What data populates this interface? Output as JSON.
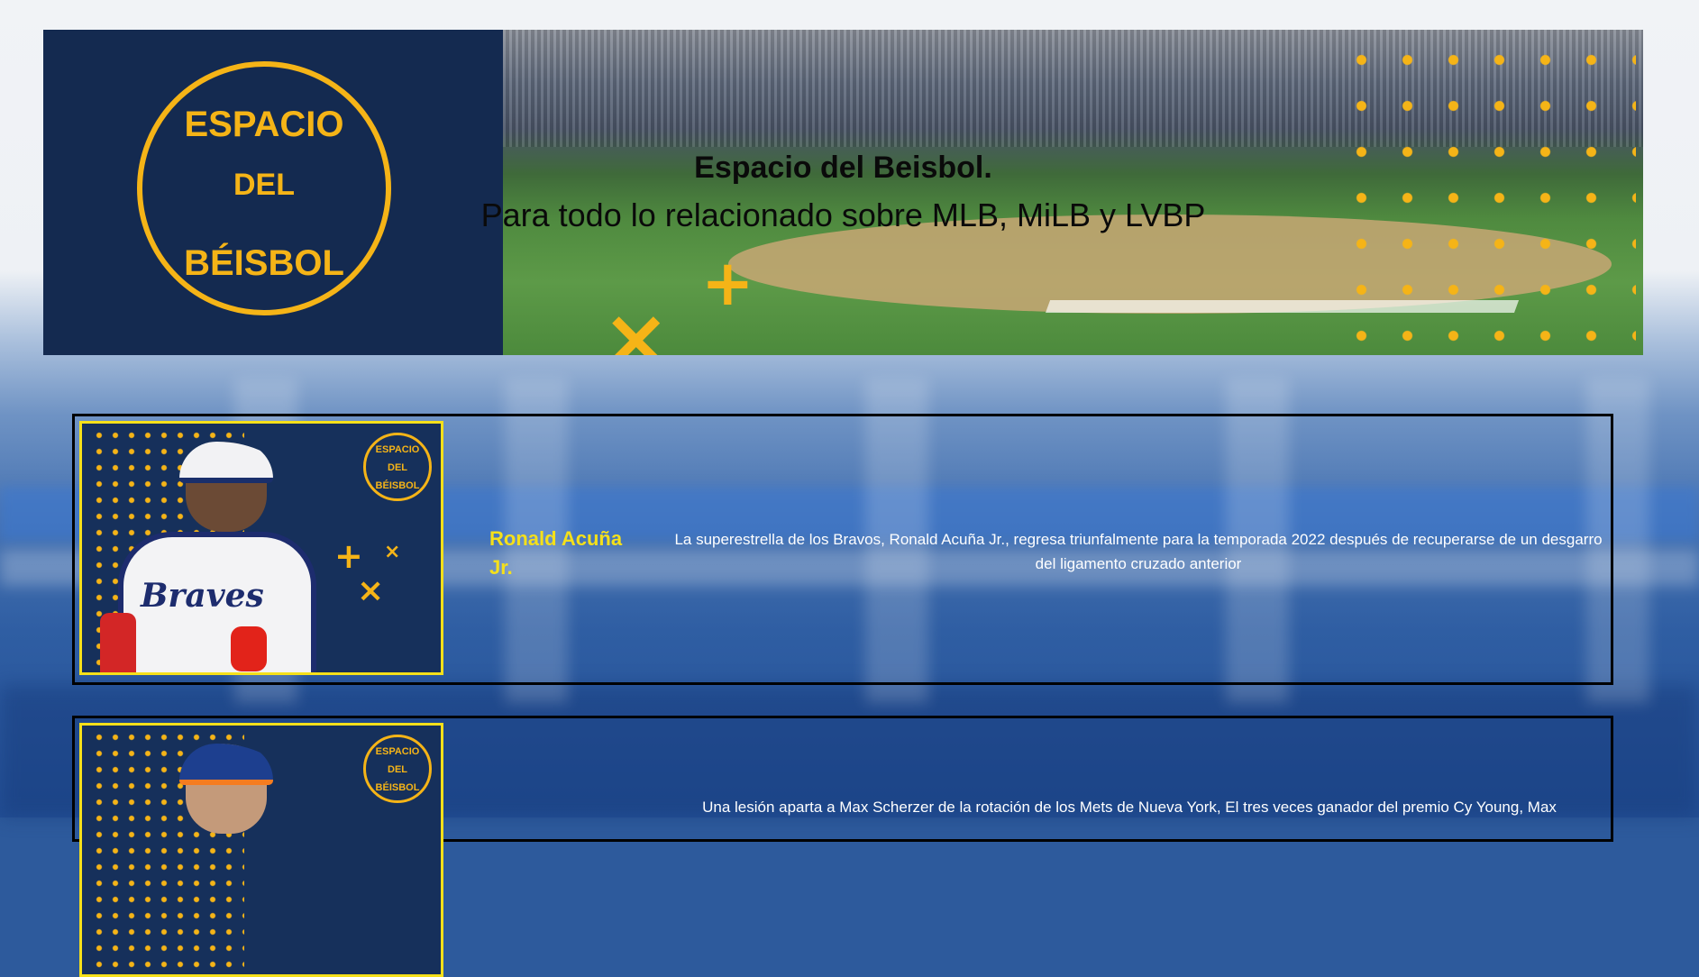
{
  "banner": {
    "logo": {
      "top": "ESPACIO",
      "middle": "DEL",
      "bottom": "BÉISBOL"
    },
    "title": "Espacio del Beisbol.",
    "subtitle": "Para todo lo relacionado sobre MLB, MiLB y LVBP"
  },
  "cards": [
    {
      "name": "Ronald Acuña Jr.",
      "description": "La superestrella de los Bravos, Ronald Acuña Jr., regresa triunfalmente para la temporada 2022 después de recuperarse de un desgarro del ligamento cruzado anterior",
      "jersey": "Braves",
      "mini_logo": "ESPACIO DEL BÉISBOL"
    },
    {
      "name": "",
      "description": "Una lesión aparta a Max Scherzer de la rotación de los Mets de Nueva York, El tres veces ganador del premio Cy Young, Max",
      "mini_logo": "ESPACIO DEL BÉISBOL"
    }
  ],
  "colors": {
    "accent": "#f5b417",
    "name_yellow": "#f5e01a",
    "navy": "#142a50"
  }
}
